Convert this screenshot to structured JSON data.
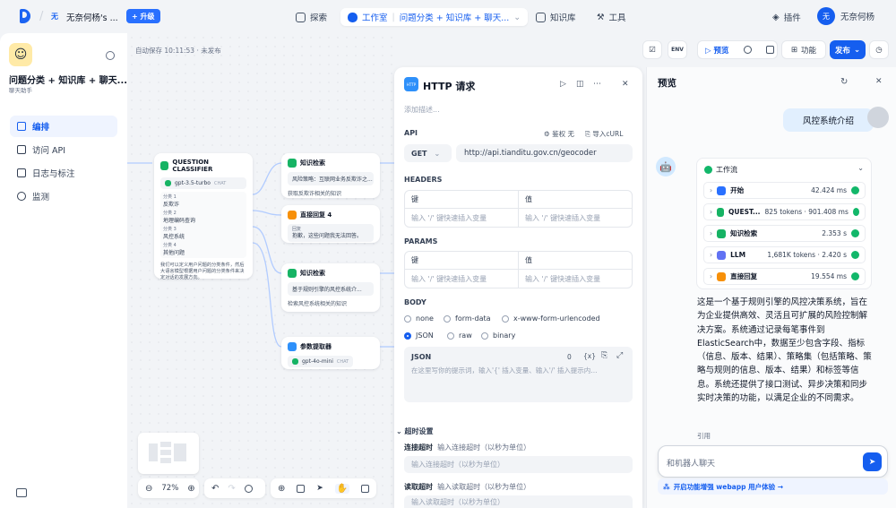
{
  "header": {
    "workspace_avatar": "无",
    "workspace_name": "无奈何杨's ...",
    "upgrade": "升级",
    "nav": {
      "explore": "探索",
      "studio": "工作室",
      "current_app": "问题分类 + 知识库 + 聊天...",
      "knowledge": "知识库",
      "tools": "工具"
    },
    "plugins": "插件",
    "user_avatar": "无",
    "user_name": "无奈何杨"
  },
  "sidebar": {
    "app_title": "问题分类 + 知识库 + 聊天...",
    "app_subtitle": "聊天助手",
    "items": [
      {
        "label": "编排",
        "active": true
      },
      {
        "label": "访问 API",
        "active": false
      },
      {
        "label": "日志与标注",
        "active": false
      },
      {
        "label": "监测",
        "active": false
      }
    ]
  },
  "canvas": {
    "autosave": "自动保存 10:11:53 · 未发布",
    "classifier": {
      "title": "QUESTION CLASSIFIER",
      "model": "gpt-3.5-turbo",
      "model_tag": "CHAT",
      "classes": [
        {
          "name": "分类 1",
          "desc": "反欺诈"
        },
        {
          "name": "分类 2",
          "desc": "地理编码查询"
        },
        {
          "name": "分类 3",
          "desc": "风控系统"
        },
        {
          "name": "分类 4",
          "desc": "其他问题"
        }
      ],
      "instruction": "我们可以定义用户问题的分类条件，然后大语言模型根据用户问题的分类条件来决定对话的发展方向。"
    },
    "kr1": {
      "title": "知识检索",
      "kb": "风险策略：互联网业务反欺诈之...",
      "desc": "获取反欺诈相关的知识"
    },
    "reply": {
      "title": "直接回复 4",
      "label": "回复",
      "text": "抱歉，这些问题我无法回答。"
    },
    "kr2": {
      "title": "知识检索",
      "kb": "基于规则引擎的风控系统介...",
      "desc": "检索风控系统相关的知识"
    },
    "extractor": {
      "title": "参数提取器",
      "model": "gpt-4o-mini",
      "model_tag": "CHAT"
    },
    "zoom": "72%"
  },
  "toolbar_right": {
    "preview": "预览",
    "features": "功能",
    "publish": "发布"
  },
  "http_panel": {
    "icon_label": "HTTP",
    "title": "HTTP 请求",
    "desc_placeholder": "添加描述...",
    "api_label": "API",
    "auth": "鉴权 无",
    "import_curl": "导入cURL",
    "method": "GET",
    "url": "http://api.tianditu.gov.cn/geocoder",
    "headers_label": "HEADERS",
    "params_label": "PARAMS",
    "key_col": "键",
    "value_col": "值",
    "kv_placeholder": "输入 '/' 键快速插入变量",
    "body_label": "BODY",
    "body_types": [
      "none",
      "form-data",
      "x-www-form-urlencoded",
      "JSON",
      "raw",
      "binary"
    ],
    "body_selected": "JSON",
    "json_label": "JSON",
    "json_count": "0",
    "json_placeholder": "在这里写你的提示词，输入'{' 插入变量、输入'/' 插入提示内...",
    "timeout_label": "超时设置",
    "connect_timeout_label": "连接超时",
    "connect_timeout_hint": "输入连接超时（以秒为单位）",
    "connect_timeout_placeholder": "输入连接超时（以秒为单位）",
    "read_timeout_label": "读取超时",
    "read_timeout_hint": "输入读取超时（以秒为单位）",
    "read_timeout_placeholder": "输入读取超时（以秒为单位）"
  },
  "preview": {
    "title": "预览",
    "user_message": "风控系统介绍",
    "workflow_label": "工作流",
    "steps": [
      {
        "name": "开始",
        "meta": "42.424 ms",
        "color": "#2970ff"
      },
      {
        "name": "QUEST...",
        "meta": "825 tokens · 901.408 ms",
        "color": "#16b364"
      },
      {
        "name": "知识检索",
        "meta": "2.353 s",
        "color": "#16b364"
      },
      {
        "name": "LLM",
        "meta": "1,681K tokens · 2.420 s",
        "color": "#6172f3"
      },
      {
        "name": "直接回复",
        "meta": "19.554 ms",
        "color": "#f79009"
      }
    ],
    "answer": "这是一个基于规则引擎的风控决策系统，旨在为企业提供高效、灵活且可扩展的风险控制解决方案。系统通过记录每笔事件到ElasticSearch中，数据至少包含字段、指标（信息、版本、结果）、策略集（包括策略、策略与规则的信息、版本、结果）和标签等信息。系统还提供了接口测试、异步决策和同步实时决策的功能，以满足企业的不同需求。",
    "reference": "引用",
    "input_placeholder": "和机器人聊天",
    "hint": "开启功能增强 webapp 用户体验 →"
  }
}
